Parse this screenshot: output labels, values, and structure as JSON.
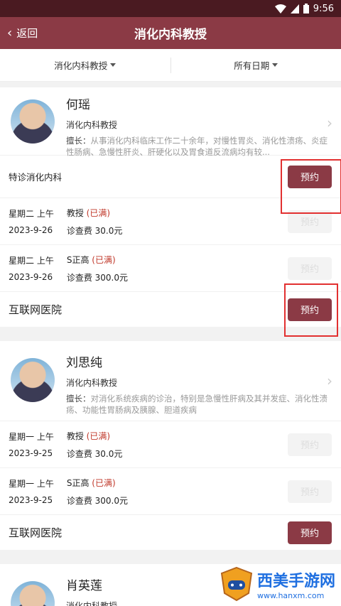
{
  "status": {
    "time": "9:56"
  },
  "header": {
    "back_label": "返回",
    "title": "消化内科教授"
  },
  "filters": [
    {
      "label": "消化内科教授"
    },
    {
      "label": "所有日期"
    }
  ],
  "doctors": [
    {
      "name": "何瑶",
      "title": "消化内科教授",
      "spec_label": "擅长：",
      "spec_text": "从事消化内科临床工作二十余年，对慢性胃炎、消化性溃疡、炎症性肠病、急慢性肝炎、肝硬化以及胃食道反流病均有较...",
      "special_clinic": "特诊消化内科",
      "special_btn": "预约",
      "slots": [
        {
          "day": "星期二 上午",
          "date": "2023-9-26",
          "level": "教授",
          "status": "(已满)",
          "fee": "诊查费 30.0元",
          "btn": "预约"
        },
        {
          "day": "星期二 上午",
          "date": "2023-9-26",
          "level": "S正高",
          "status": "(已满)",
          "fee": "诊查费 300.0元",
          "btn": "预约"
        }
      ],
      "hospital": "互联网医院",
      "hospital_btn": "预约"
    },
    {
      "name": "刘思纯",
      "title": "消化内科教授",
      "spec_label": "擅长：",
      "spec_text": "对消化系统疾病的诊治，特别是急慢性肝病及其并发症、消化性溃疡、功能性胃肠病及胰腺、胆道疾病",
      "slots": [
        {
          "day": "星期一 上午",
          "date": "2023-9-25",
          "level": "教授",
          "status": "(已满)",
          "fee": "诊查费 30.0元",
          "btn": "预约"
        },
        {
          "day": "星期一 上午",
          "date": "2023-9-25",
          "level": "S正高",
          "status": "(已满)",
          "fee": "诊查费 300.0元",
          "btn": "预约"
        }
      ],
      "hospital": "互联网医院",
      "hospital_btn": "预约"
    },
    {
      "name": "肖英莲",
      "title": "消化内科教授"
    }
  ],
  "watermark": {
    "name": "西美手游网",
    "url": "www.hanxm.com"
  },
  "colors": {
    "brand": "#8b3a45",
    "statusbar": "#4a1a21",
    "full": "#c0392b",
    "highlight": "#e23030"
  }
}
